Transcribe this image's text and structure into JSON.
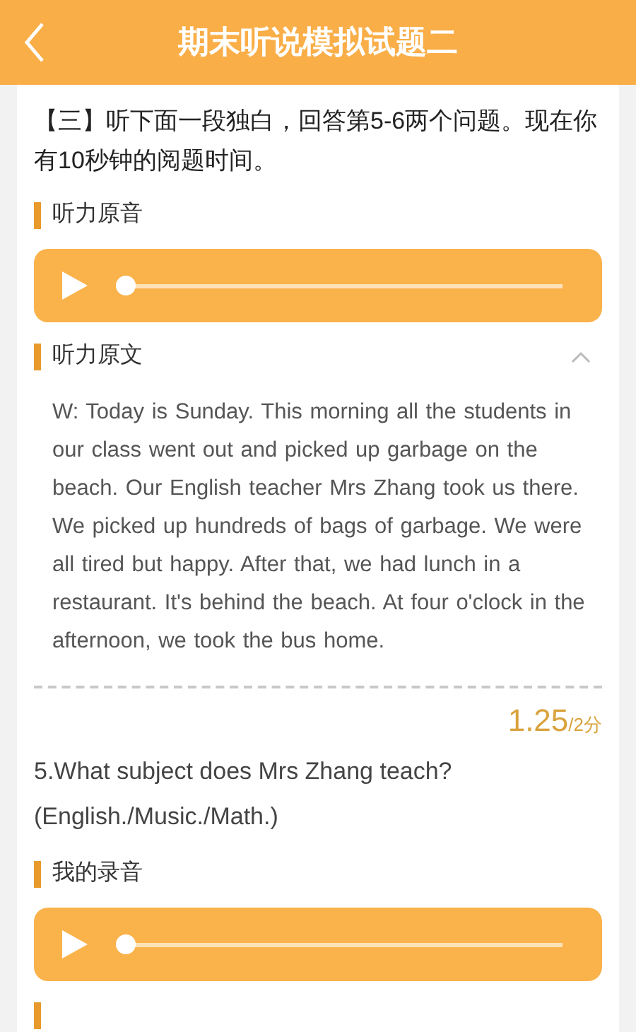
{
  "header": {
    "title": "期末听说模拟试题二"
  },
  "instruction": "【三】听下面一段独白，回答第5-6两个问题。现在你有10秒钟的阅题时间。",
  "original_audio": {
    "heading": "听力原音",
    "player": {
      "level": 0
    }
  },
  "transcript": {
    "heading": "听力原文",
    "expanded": true,
    "text": "W: Today is Sunday. This morning all the students in our class went out and picked up garbage on the beach. Our English teacher Mrs Zhang took us there. We picked up hundreds of bags of garbage. We were all tired but happy. After that, we had lunch in a restaurant. It's behind the beach. At four o'clock in the afternoon, we took the bus home."
  },
  "score": {
    "value": "1.25",
    "total": "/2分"
  },
  "question": "5.What subject does Mrs Zhang teach?(English./Music./Math.)",
  "my_recording": {
    "heading": "我的录音",
    "player": {
      "level": 0
    }
  }
}
